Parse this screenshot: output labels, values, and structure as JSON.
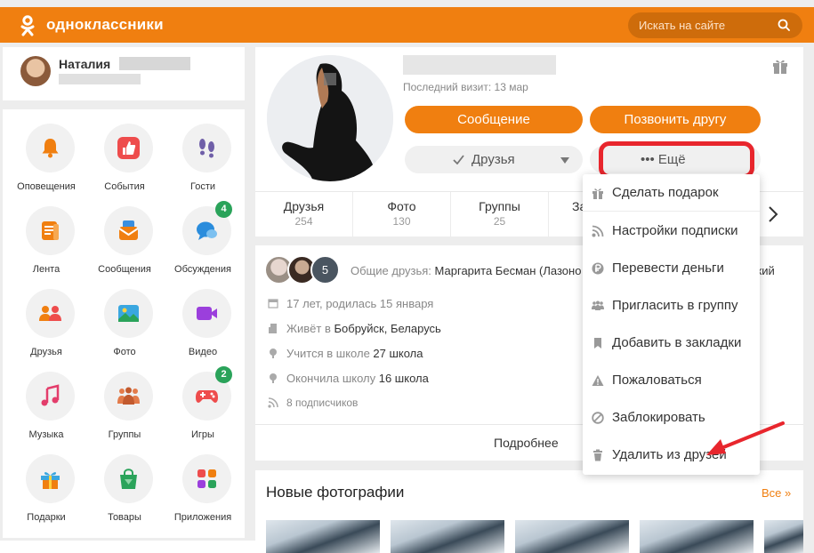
{
  "header": {
    "brand": "одноклассники",
    "search_placeholder": "Искать на сайте",
    "accent": "#f07f10"
  },
  "me": {
    "first_name": "Наталия"
  },
  "menu": {
    "items": [
      {
        "label": "Оповещения",
        "icon": "bell-icon",
        "color": "#f07f10"
      },
      {
        "label": "События",
        "icon": "thumbs-up-icon",
        "color": "#ee4c4c"
      },
      {
        "label": "Гости",
        "icon": "footprints-icon",
        "color": "#6f5fa8"
      },
      {
        "label": "Лента",
        "icon": "feed-icon",
        "color": "#f07f10"
      },
      {
        "label": "Сообщения",
        "icon": "messages-icon",
        "color": "#f07f10"
      },
      {
        "label": "Обсуждения",
        "icon": "discussions-icon",
        "color": "#2a8cdc",
        "badge": "4"
      },
      {
        "label": "Друзья",
        "icon": "friends-icon",
        "color": "#f07f10"
      },
      {
        "label": "Фото",
        "icon": "photo-icon",
        "color": "#3aa7e0"
      },
      {
        "label": "Видео",
        "icon": "video-icon",
        "color": "#9b3fdc"
      },
      {
        "label": "Музыка",
        "icon": "music-icon",
        "color": "#e33d6b"
      },
      {
        "label": "Группы",
        "icon": "groups-icon",
        "color": "#c25a2e"
      },
      {
        "label": "Игры",
        "icon": "gamepad-icon",
        "color": "#ee4c4c",
        "badge": "2"
      },
      {
        "label": "Подарки",
        "icon": "gift-icon",
        "color": "#3aa7e0"
      },
      {
        "label": "Товары",
        "icon": "shopping-bag-icon",
        "color": "#2aa35a"
      },
      {
        "label": "Приложения",
        "icon": "apps-icon",
        "color": "#f07f10"
      }
    ]
  },
  "profile": {
    "last_visit": "Последний визит: 13 мар",
    "message_button": "Сообщение",
    "call_button": "Позвонить другу",
    "friends_button": "Друзья",
    "more_button": "••• Ещё",
    "counters": [
      {
        "label": "Друзья",
        "value": "254"
      },
      {
        "label": "Фото",
        "value": "130"
      },
      {
        "label": "Группы",
        "value": "25"
      },
      {
        "label": "За",
        "value": ""
      }
    ]
  },
  "info": {
    "mutual_count": "5",
    "mutual_label": "Общие друзья:",
    "mutual_names": "Маргарита Бесман (Лазоно",
    "mutual_tail": "ский",
    "rows": [
      {
        "icon": "calendar-icon",
        "text": "17 лет, родилась 15 января",
        "bold": ""
      },
      {
        "icon": "building-icon",
        "text": "Живёт в ",
        "bold": "Бобруйск, Беларусь"
      },
      {
        "icon": "school-icon",
        "text": "Учится в школе ",
        "bold": "27 школа"
      },
      {
        "icon": "school-icon",
        "text": "Окончила школу ",
        "bold": "16 школа"
      },
      {
        "icon": "rss-icon",
        "text": "8 подписчиков",
        "bold": ""
      }
    ],
    "more_link": "Подробнее"
  },
  "photos": {
    "title": "Новые фотографии",
    "all_link": "Все »"
  },
  "dropdown": {
    "items": [
      {
        "label": "Сделать подарок",
        "icon": "gift-icon"
      },
      {
        "label": "Настройки подписки",
        "icon": "rss-icon"
      },
      {
        "label": "Перевести деньги",
        "icon": "ruble-icon"
      },
      {
        "label": "Пригласить в группу",
        "icon": "group-invite-icon"
      },
      {
        "label": "Добавить в закладки",
        "icon": "bookmark-icon"
      },
      {
        "label": "Пожаловаться",
        "icon": "warning-icon"
      },
      {
        "label": "Заблокировать",
        "icon": "block-icon"
      },
      {
        "label": "Удалить из друзей",
        "icon": "trash-icon"
      }
    ]
  },
  "annotation": {
    "highlight_color": "#e8262d"
  }
}
